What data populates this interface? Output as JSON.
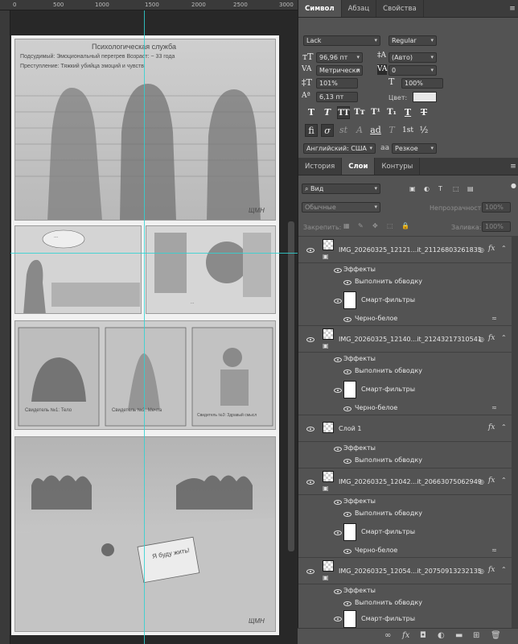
{
  "ruler": {
    "marks": [
      "0",
      "500",
      "1000",
      "1500",
      "2000",
      "2500",
      "3000"
    ]
  },
  "artwork": {
    "header_title": "Психологическая служба",
    "subject_line": "Подсудимый: Эмоциональный перегрев   Возраст: ~ 33 года",
    "crime_line": "Преступление: Тяжкий убийца эмоций и чувств",
    "speech_bubble": "...",
    "caption_mid": "...",
    "witness1": "Свидетель №1: Тело",
    "witness2": "Свидетель №2: Мечта",
    "witness3": "Свидетель №3: Здравый смысл",
    "note": "Я буду жить!",
    "signature": "ЩМН"
  },
  "character_panel": {
    "tabs": [
      "Символ",
      "Абзац",
      "Свойства"
    ],
    "font_family": "Lack",
    "font_style": "Regular",
    "font_size": "96,96 пт",
    "leading": "(Авто)",
    "kerning": "Метрически",
    "tracking": "0",
    "vertical_scale": "101%",
    "horizontal_scale": "100%",
    "baseline_shift": "6,13 пт",
    "color_label": "Цвет:",
    "color_swatch": "#e8e8e8",
    "style_buttons": [
      "T",
      "T",
      "TT",
      "Tт",
      "T¹",
      "T₁",
      "T",
      "T"
    ],
    "opentype_buttons": [
      "fi",
      "σ",
      "st",
      "A",
      "ad",
      "T",
      "1st",
      "½"
    ],
    "language": "Английский: США",
    "aa_icon": "aa",
    "antialias": "Резкое"
  },
  "layers_panel": {
    "tabs": [
      "История",
      "Слои",
      "Контуры"
    ],
    "filter_kind": "Вид",
    "blend_mode": "Обычные",
    "opacity_label": "Непрозрачность:",
    "opacity_value": "100%",
    "lock_label": "Закрепить:",
    "fill_label": "Заливка:",
    "fill_value": "100%",
    "layers": [
      {
        "name": "IMG_20260325_12121...it_21126803261835",
        "effects": "Эффекты",
        "stroke": "Выполнить обводку",
        "smart": "Смарт-фильтры",
        "bw": "Черно-белое"
      },
      {
        "name": "IMG_20260325_12140...it_21243217310541",
        "effects": "Эффекты",
        "stroke": "Выполнить обводку",
        "smart": "Смарт-фильтры",
        "bw": "Черно-белое"
      },
      {
        "name": "Слой 1",
        "effects": "Эффекты",
        "stroke": "Выполнить обводку"
      },
      {
        "name": "IMG_20260325_12042...it_20663075062949",
        "effects": "Эффекты",
        "stroke": "Выполнить обводку",
        "smart": "Смарт-фильтры",
        "bw": "Черно-белое"
      },
      {
        "name": "IMG_20260325_12054...it_20750913232135",
        "effects": "Эффекты",
        "stroke": "Выполнить обводку",
        "smart": "Смарт-фильтры"
      }
    ]
  }
}
